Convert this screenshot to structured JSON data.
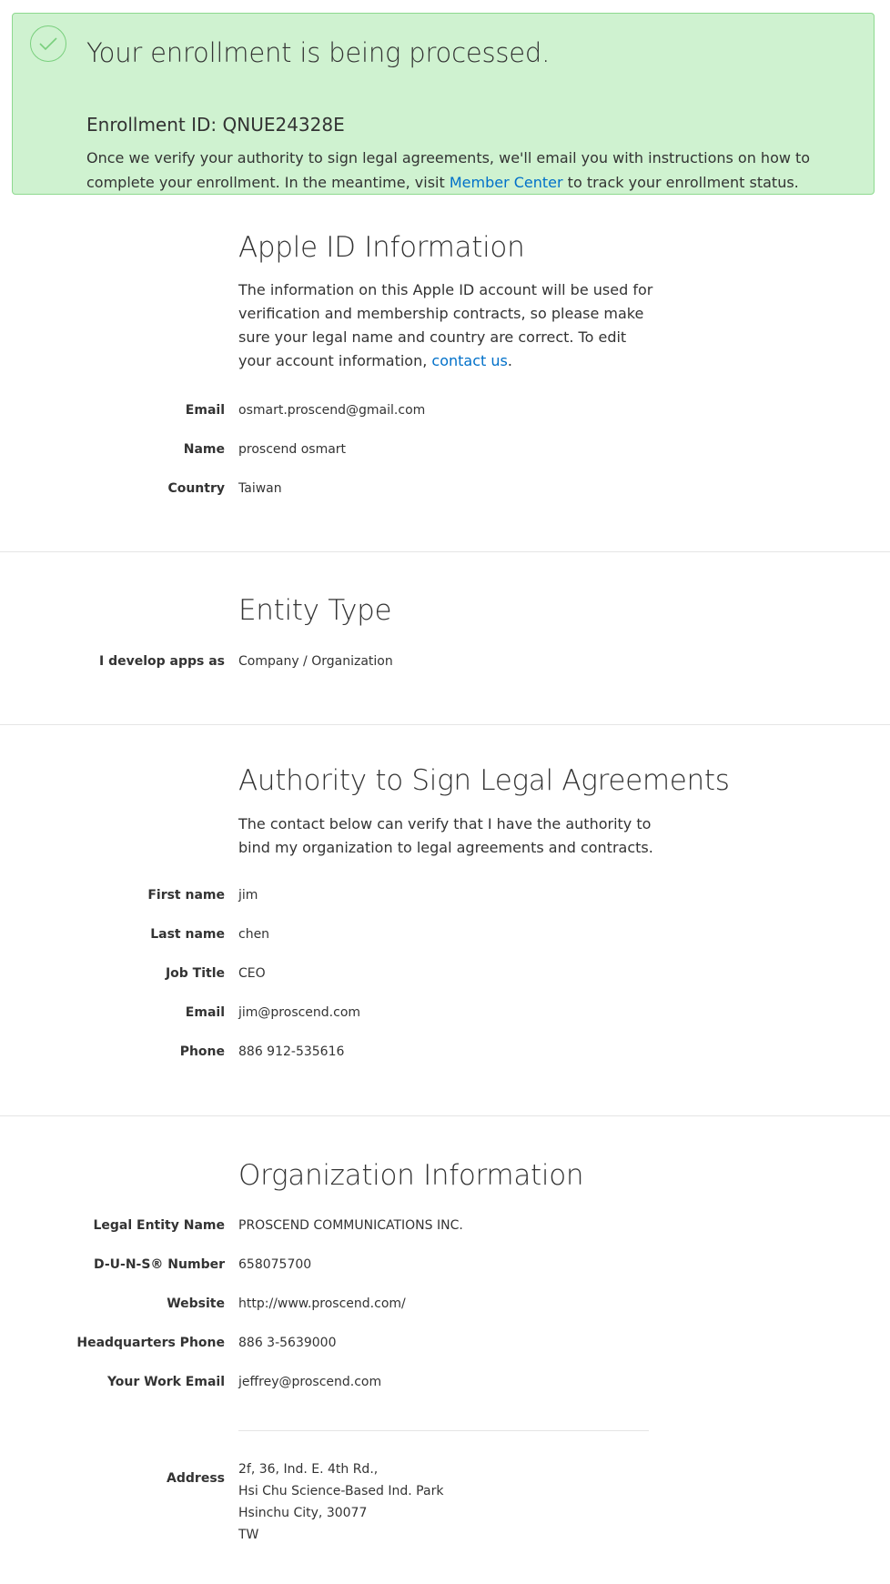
{
  "banner": {
    "title": "Your enrollment is being processed.",
    "enrollment_id": "Enrollment ID: QNUE24328E",
    "body_before": "Once we verify your authority to sign legal agreements, we'll email you with instructions on how to complete your enrollment. In the meantime, visit ",
    "link": "Member Center",
    "body_after": " to track your enrollment status.",
    "icon": "checkmark-circle-icon",
    "colors": {
      "background": "#cff2d0",
      "border": "#8ed98f",
      "check": "#79cf7d"
    }
  },
  "apple_id": {
    "title": "Apple ID Information",
    "desc_before": "The information on this Apple ID account will be used for verification and membership contracts, so please make sure your legal name and country are correct. To edit your account information, ",
    "desc_link": "contact us",
    "desc_after": ".",
    "fields": [
      {
        "label": "Email",
        "value": "osmart.proscend@gmail.com"
      },
      {
        "label": "Name",
        "value": "proscend osmart"
      },
      {
        "label": "Country",
        "value": "Taiwan"
      }
    ]
  },
  "entity": {
    "title": "Entity Type",
    "fields": [
      {
        "label": "I develop apps as",
        "value": "Company / Organization"
      }
    ]
  },
  "authority": {
    "title": "Authority to Sign Legal Agreements",
    "desc": "The contact below can verify that I have the authority to bind my organization to legal agreements and contracts.",
    "fields": [
      {
        "label": "First name",
        "value": "jim"
      },
      {
        "label": "Last name",
        "value": "chen"
      },
      {
        "label": "Job Title",
        "value": "CEO"
      },
      {
        "label": "Email",
        "value": "jim@proscend.com"
      },
      {
        "label": "Phone",
        "value": "886 912-535616"
      }
    ]
  },
  "organization": {
    "title": "Organization Information",
    "fields": [
      {
        "label": "Legal Entity Name",
        "value": "PROSCEND COMMUNICATIONS INC."
      },
      {
        "label": "D-U-N-S® Number",
        "value": "658075700"
      },
      {
        "label": "Website",
        "value": "http://www.proscend.com/"
      },
      {
        "label": "Headquarters Phone",
        "value": "886 3-5639000"
      },
      {
        "label": "Your Work Email",
        "value": "jeffrey@proscend.com"
      }
    ],
    "address": {
      "label": "Address",
      "lines": [
        "2f, 36, Ind. E. 4th Rd.,",
        "Hsi Chu Science-Based Ind. Park",
        "Hsinchu City, 30077",
        "TW"
      ]
    }
  },
  "link_color": "#0070c9"
}
